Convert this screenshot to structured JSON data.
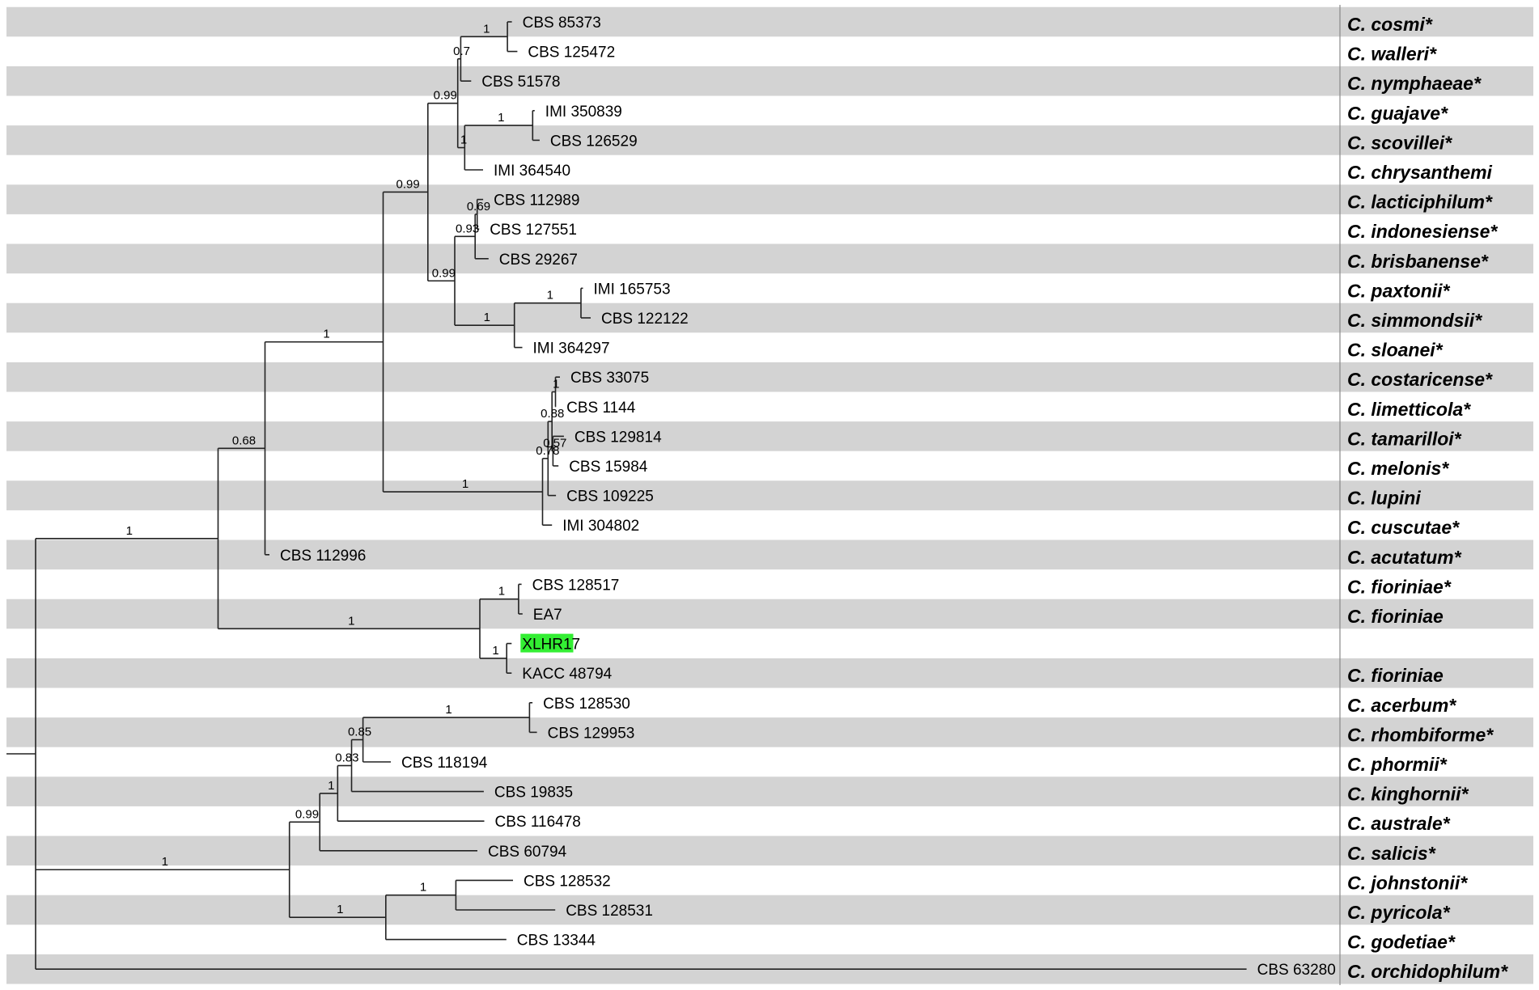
{
  "highlight_color": "#33ee33",
  "stripe_color": "#d3d3d3",
  "tree": {
    "children": [
      {
        "support": "1",
        "bl": 0.2255,
        "children": [
          {
            "support": "0.68",
            "bl": 0.058,
            "children": [
              {
                "support": "1",
                "bl": 0.146,
                "children": [
                  {
                    "support": "0.99",
                    "bl": 0.0553,
                    "children": [
                      {
                        "support": "0.99",
                        "bl": 0.0369,
                        "children": [
                          {
                            "support": "0.7",
                            "bl": 0.0037,
                            "children": [
                              {
                                "support": "1",
                                "bl": 0.0577,
                                "children": [
                                  {
                                    "name": "CBS 85373",
                                    "species": "C. cosmi*",
                                    "bl": 0.0055
                                  },
                                  {
                                    "name": "CBS 125472",
                                    "species": "C. walleri*",
                                    "bl": 0.0123
                                  }
                                ]
                              },
                              {
                                "name": "CBS 51578",
                                "species": "C. nymphaeae*",
                                "bl": 0.0129
                              }
                            ]
                          },
                          {
                            "support": "1",
                            "bl": 0.0086,
                            "children": [
                              {
                                "support": "1",
                                "bl": 0.084,
                                "children": [
                                  {
                                    "name": "IMI 350839",
                                    "species": "C. guajave*",
                                    "bl": 0.0025
                                  },
                                  {
                                    "name": "CBS 126529",
                                    "species": "C. scovillei*",
                                    "bl": 0.0086
                                  }
                                ]
                              },
                              {
                                "name": "IMI 364540",
                                "species": "C. chrysanthemi",
                                "bl": 0.0227
                              }
                            ]
                          }
                        ]
                      },
                      {
                        "support": "0.99",
                        "bl": 0.0332,
                        "children": [
                          {
                            "support": "0.93",
                            "bl": 0.0252,
                            "children": [
                              {
                                "support": "0.69",
                                "bl": 0.0025,
                                "children": [
                                  {
                                    "name": "CBS 112989",
                                    "species": "C. lacticiphilum*",
                                    "bl": 0.0074
                                  },
                                  {
                                    "name": "CBS 127551",
                                    "species": "C. indonesiense*",
                                    "bl": 0.0025
                                  }
                                ]
                              },
                              {
                                "name": "CBS 29267",
                                "species": "C. brisbanense*",
                                "bl": 0.0166
                              }
                            ]
                          },
                          {
                            "support": "1",
                            "bl": 0.0737,
                            "children": [
                              {
                                "support": "1",
                                "bl": 0.0823,
                                "children": [
                                  {
                                    "name": "IMI 165753",
                                    "species": "C. paxtonii*",
                                    "bl": 0.0025
                                  },
                                  {
                                    "name": "CBS 122122",
                                    "species": "C. simmondsii*",
                                    "bl": 0.012
                                  }
                                ]
                              },
                              {
                                "name": "IMI 364297",
                                "species": "C. sloanei*",
                                "bl": 0.0098
                              }
                            ]
                          }
                        ]
                      }
                    ]
                  },
                  {
                    "support": "1",
                    "bl": 0.197,
                    "children": [
                      {
                        "support": "0.78",
                        "bl": 0.0068,
                        "children": [
                          {
                            "support": "0.88",
                            "bl": 0.0049,
                            "children": [
                              {
                                "support": "1",
                                "bl": 0.0043,
                                "children": [
                                  {
                                    "name": "CBS 33075",
                                    "species": "C. costaricense*",
                                    "bl": 0.0055
                                  },
                                  {
                                    "name": "CBS 1144",
                                    "species": "C. limetticola*",
                                    "bl": 0.0006
                                  }
                                ]
                              },
                              {
                                "support": "0.57",
                                "bl": 0.0012,
                                "children": [
                                  {
                                    "name": "CBS 129814",
                                    "species": "C. tamarilloi*",
                                    "bl": 0.0135
                                  },
                                  {
                                    "name": "CBS 15984",
                                    "species": "C. melonis*",
                                    "bl": 0.0068
                                  }
                                ]
                              }
                            ]
                          },
                          {
                            "name": "CBS 109225",
                            "species": "C. lupini",
                            "bl": 0.0098
                          }
                        ]
                      },
                      {
                        "name": "IMI 304802",
                        "species": "C. cuscutae*",
                        "bl": 0.0117
                      }
                    ]
                  }
                ]
              },
              {
                "name": "CBS 112996",
                "species": "C. acutatum*",
                "bl": 0.0055
              }
            ]
          },
          {
            "support": "1",
            "bl": 0.3235,
            "children": [
              {
                "support": "1",
                "bl": 0.0479,
                "children": [
                  {
                    "name": "CBS 128517",
                    "species": "C. fioriniae*",
                    "bl": 0.0037
                  },
                  {
                    "name": "EA7",
                    "species": "C. fioriniae",
                    "bl": 0.0049
                  }
                ]
              },
              {
                "support": "1",
                "bl": 0.0332,
                "children": [
                  {
                    "name": "XLHR17",
                    "species": "",
                    "highlight": true,
                    "bl": 0.0061
                  },
                  {
                    "name": "KACC 48794",
                    "species": "C. fioriniae",
                    "bl": 0.0061
                  }
                ]
              }
            ]
          }
        ]
      },
      {
        "support": "1",
        "bl": 0.3137,
        "children": [
          {
            "support": "0.99",
            "bl": 0.0375,
            "children": [
              {
                "support": "1",
                "bl": 0.0221,
                "children": [
                  {
                    "support": "0.83",
                    "bl": 0.0172,
                    "children": [
                      {
                        "support": "0.85",
                        "bl": 0.0141,
                        "children": [
                          {
                            "support": "1",
                            "bl": 0.2058,
                            "children": [
                              {
                                "name": "CBS 128530",
                                "species": "C. acerbum*",
                                "bl": 0.0037
                              },
                              {
                                "name": "CBS 129953",
                                "species": "C. rhombiforme*",
                                "bl": 0.0092
                              }
                            ]
                          },
                          {
                            "name": "CBS 118194",
                            "species": "C. phormii*",
                            "bl": 0.0344
                          }
                        ]
                      },
                      {
                        "name": "CBS 19835",
                        "species": "C. kinghornii*",
                        "bl": 0.1634
                      }
                    ]
                  },
                  {
                    "name": "CBS 116478",
                    "species": "C. australe*",
                    "bl": 0.1812
                  }
                ]
              },
              {
                "name": "CBS 60794",
                "species": "C. salicis*",
                "bl": 0.1948
              }
            ]
          },
          {
            "support": "1",
            "bl": 0.1191,
            "children": [
              {
                "support": "1",
                "bl": 0.0866,
                "children": [
                  {
                    "name": "CBS 128532",
                    "species": "C. johnstonii*",
                    "bl": 0.0706
                  },
                  {
                    "name": "CBS 128531",
                    "species": "C. pyricola*",
                    "bl": 0.1228
                  }
                ]
              },
              {
                "name": "CBS 13344",
                "species": "C. godetiae*",
                "bl": 0.149
              }
            ]
          }
        ]
      },
      {
        "name": "CBS 63280",
        "species": "C. orchidophilum*",
        "bl": 1.4966
      }
    ]
  }
}
